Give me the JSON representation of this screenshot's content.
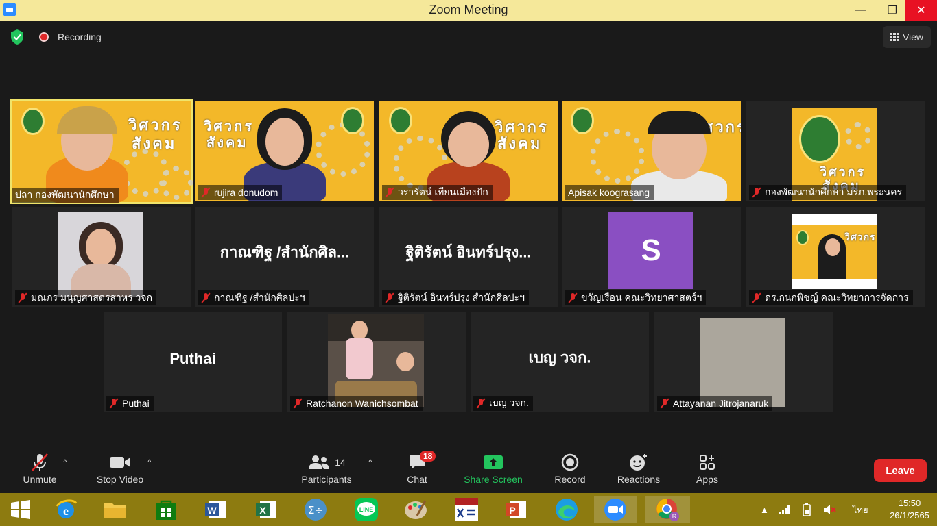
{
  "window": {
    "title": "Zoom Meeting",
    "minimize": "—",
    "maximize": "❐",
    "close": "✕"
  },
  "topbar": {
    "recording_label": "Recording",
    "view_label": "View"
  },
  "poster": {
    "brand_line1": "วิศวกร",
    "brand_line2": "สังคม"
  },
  "participants": [
    {
      "name": "ปลา กองพัฒนานักศึกษา"
    },
    {
      "name": "rujira donudom"
    },
    {
      "name": "วรารัตน์ เทียนเมืองปัก"
    },
    {
      "name": "Apisak koograsang"
    },
    {
      "name": "กองพัฒนานักศึกษา มรภ.พระนคร"
    },
    {
      "name": "มณภร มนุญศาสตรสาหร วจก"
    },
    {
      "name": "กาณฑิฐ /สำนักศิลปะฯ",
      "display": "กาณฑิฐ /สำนักศิล..."
    },
    {
      "name": "ฐิติรัตน์ อินทร์ปรุง สำนักศิลปะฯ",
      "display": "ฐิติรัตน์ อินทร์ปรุง..."
    },
    {
      "name": "ขวัญเรือน คณะวิทยาศาสตร์ฯ",
      "avatar_letter": "S"
    },
    {
      "name": "ดร.กนกพิชญ์ คณะวิทยาการจัดการ"
    },
    {
      "name": "Puthai",
      "display": "Puthai"
    },
    {
      "name": "Ratchanon Wanichsombat"
    },
    {
      "name": "เบญ วจก.",
      "display": "เบญ วจก."
    },
    {
      "name": "Attayanan Jitrojanaruk"
    }
  ],
  "toolbar": {
    "unmute": "Unmute",
    "stop_video": "Stop Video",
    "participants": "Participants",
    "participants_count": "14",
    "chat": "Chat",
    "chat_badge": "18",
    "share_screen": "Share Screen",
    "record": "Record",
    "reactions": "Reactions",
    "apps": "Apps",
    "leave": "Leave"
  },
  "taskbar": {
    "language": "ไทย",
    "time": "15:50",
    "date": "26/1/2565"
  },
  "colors": {
    "title_bar": "#f5e89a",
    "leave": "#e02828",
    "share_green": "#23c55e",
    "active_border": "#f0e46a",
    "taskbar": "#8d7b10"
  }
}
